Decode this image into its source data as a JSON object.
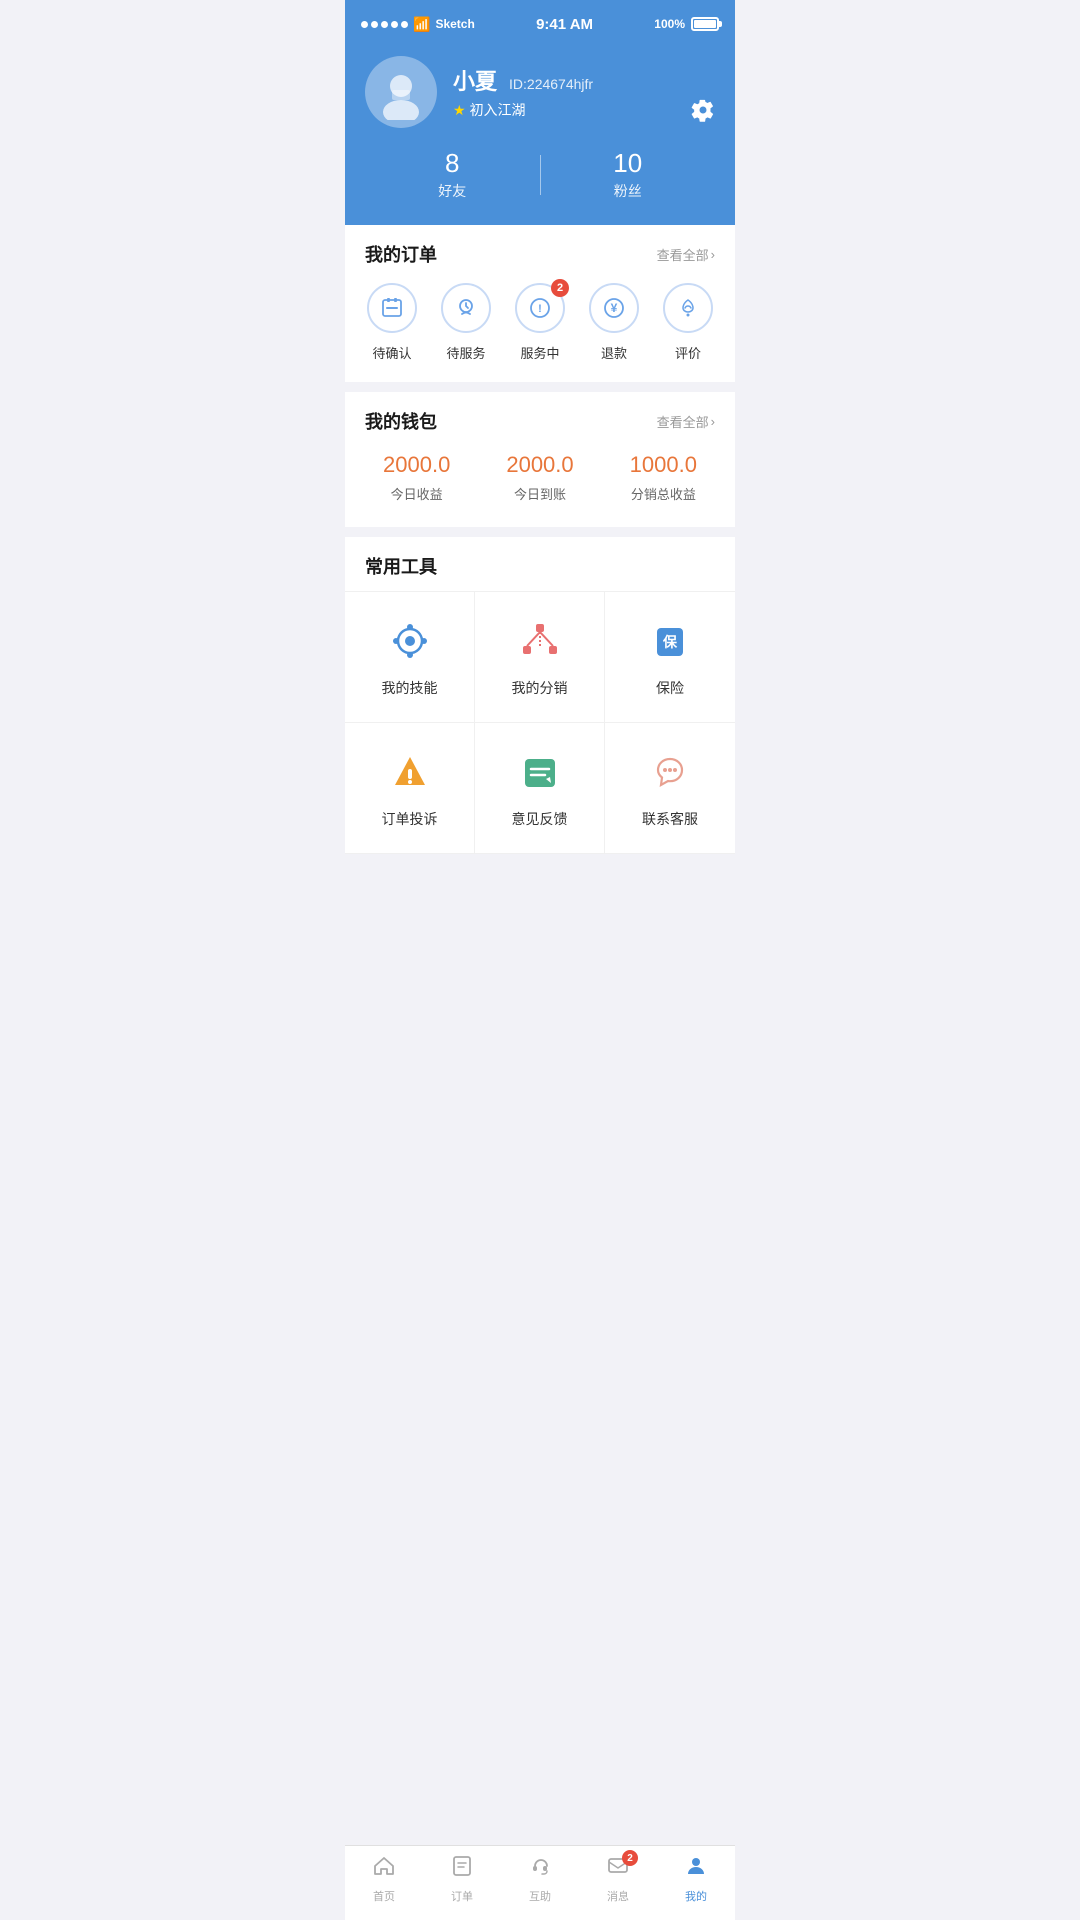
{
  "statusBar": {
    "carrier": "Sketch",
    "time": "9:41 AM",
    "battery": "100%"
  },
  "profile": {
    "name": "小夏",
    "id": "ID:224674hjfr",
    "rank": "初入江湖",
    "friends_count": "8",
    "friends_label": "好友",
    "fans_count": "10",
    "fans_label": "粉丝"
  },
  "orders": {
    "title": "我的订单",
    "view_all": "查看全部",
    "items": [
      {
        "label": "待确认",
        "badge": null,
        "icon": "pending"
      },
      {
        "label": "待服务",
        "badge": null,
        "icon": "waiting"
      },
      {
        "label": "服务中",
        "badge": "2",
        "icon": "inservice"
      },
      {
        "label": "退款",
        "badge": null,
        "icon": "refund"
      },
      {
        "label": "评价",
        "badge": null,
        "icon": "review"
      }
    ]
  },
  "wallet": {
    "title": "我的钱包",
    "view_all": "查看全部",
    "items": [
      {
        "amount": "2000.0",
        "label": "今日收益"
      },
      {
        "amount": "2000.0",
        "label": "今日到账"
      },
      {
        "amount": "1000.0",
        "label": "分销总收益"
      }
    ]
  },
  "tools": {
    "title": "常用工具",
    "items": [
      {
        "label": "我的技能",
        "icon": "skill"
      },
      {
        "label": "我的分销",
        "icon": "distribution"
      },
      {
        "label": "保险",
        "icon": "insurance"
      },
      {
        "label": "订单投诉",
        "icon": "complaint"
      },
      {
        "label": "意见反馈",
        "icon": "feedback"
      },
      {
        "label": "联系客服",
        "icon": "service"
      }
    ]
  },
  "bottomNav": {
    "items": [
      {
        "label": "首页",
        "icon": "home",
        "active": false,
        "badge": null
      },
      {
        "label": "订单",
        "icon": "order",
        "active": false,
        "badge": null
      },
      {
        "label": "互助",
        "icon": "help",
        "active": false,
        "badge": null
      },
      {
        "label": "消息",
        "icon": "message",
        "active": false,
        "badge": "2"
      },
      {
        "label": "我的",
        "icon": "profile",
        "active": true,
        "badge": null
      }
    ]
  }
}
